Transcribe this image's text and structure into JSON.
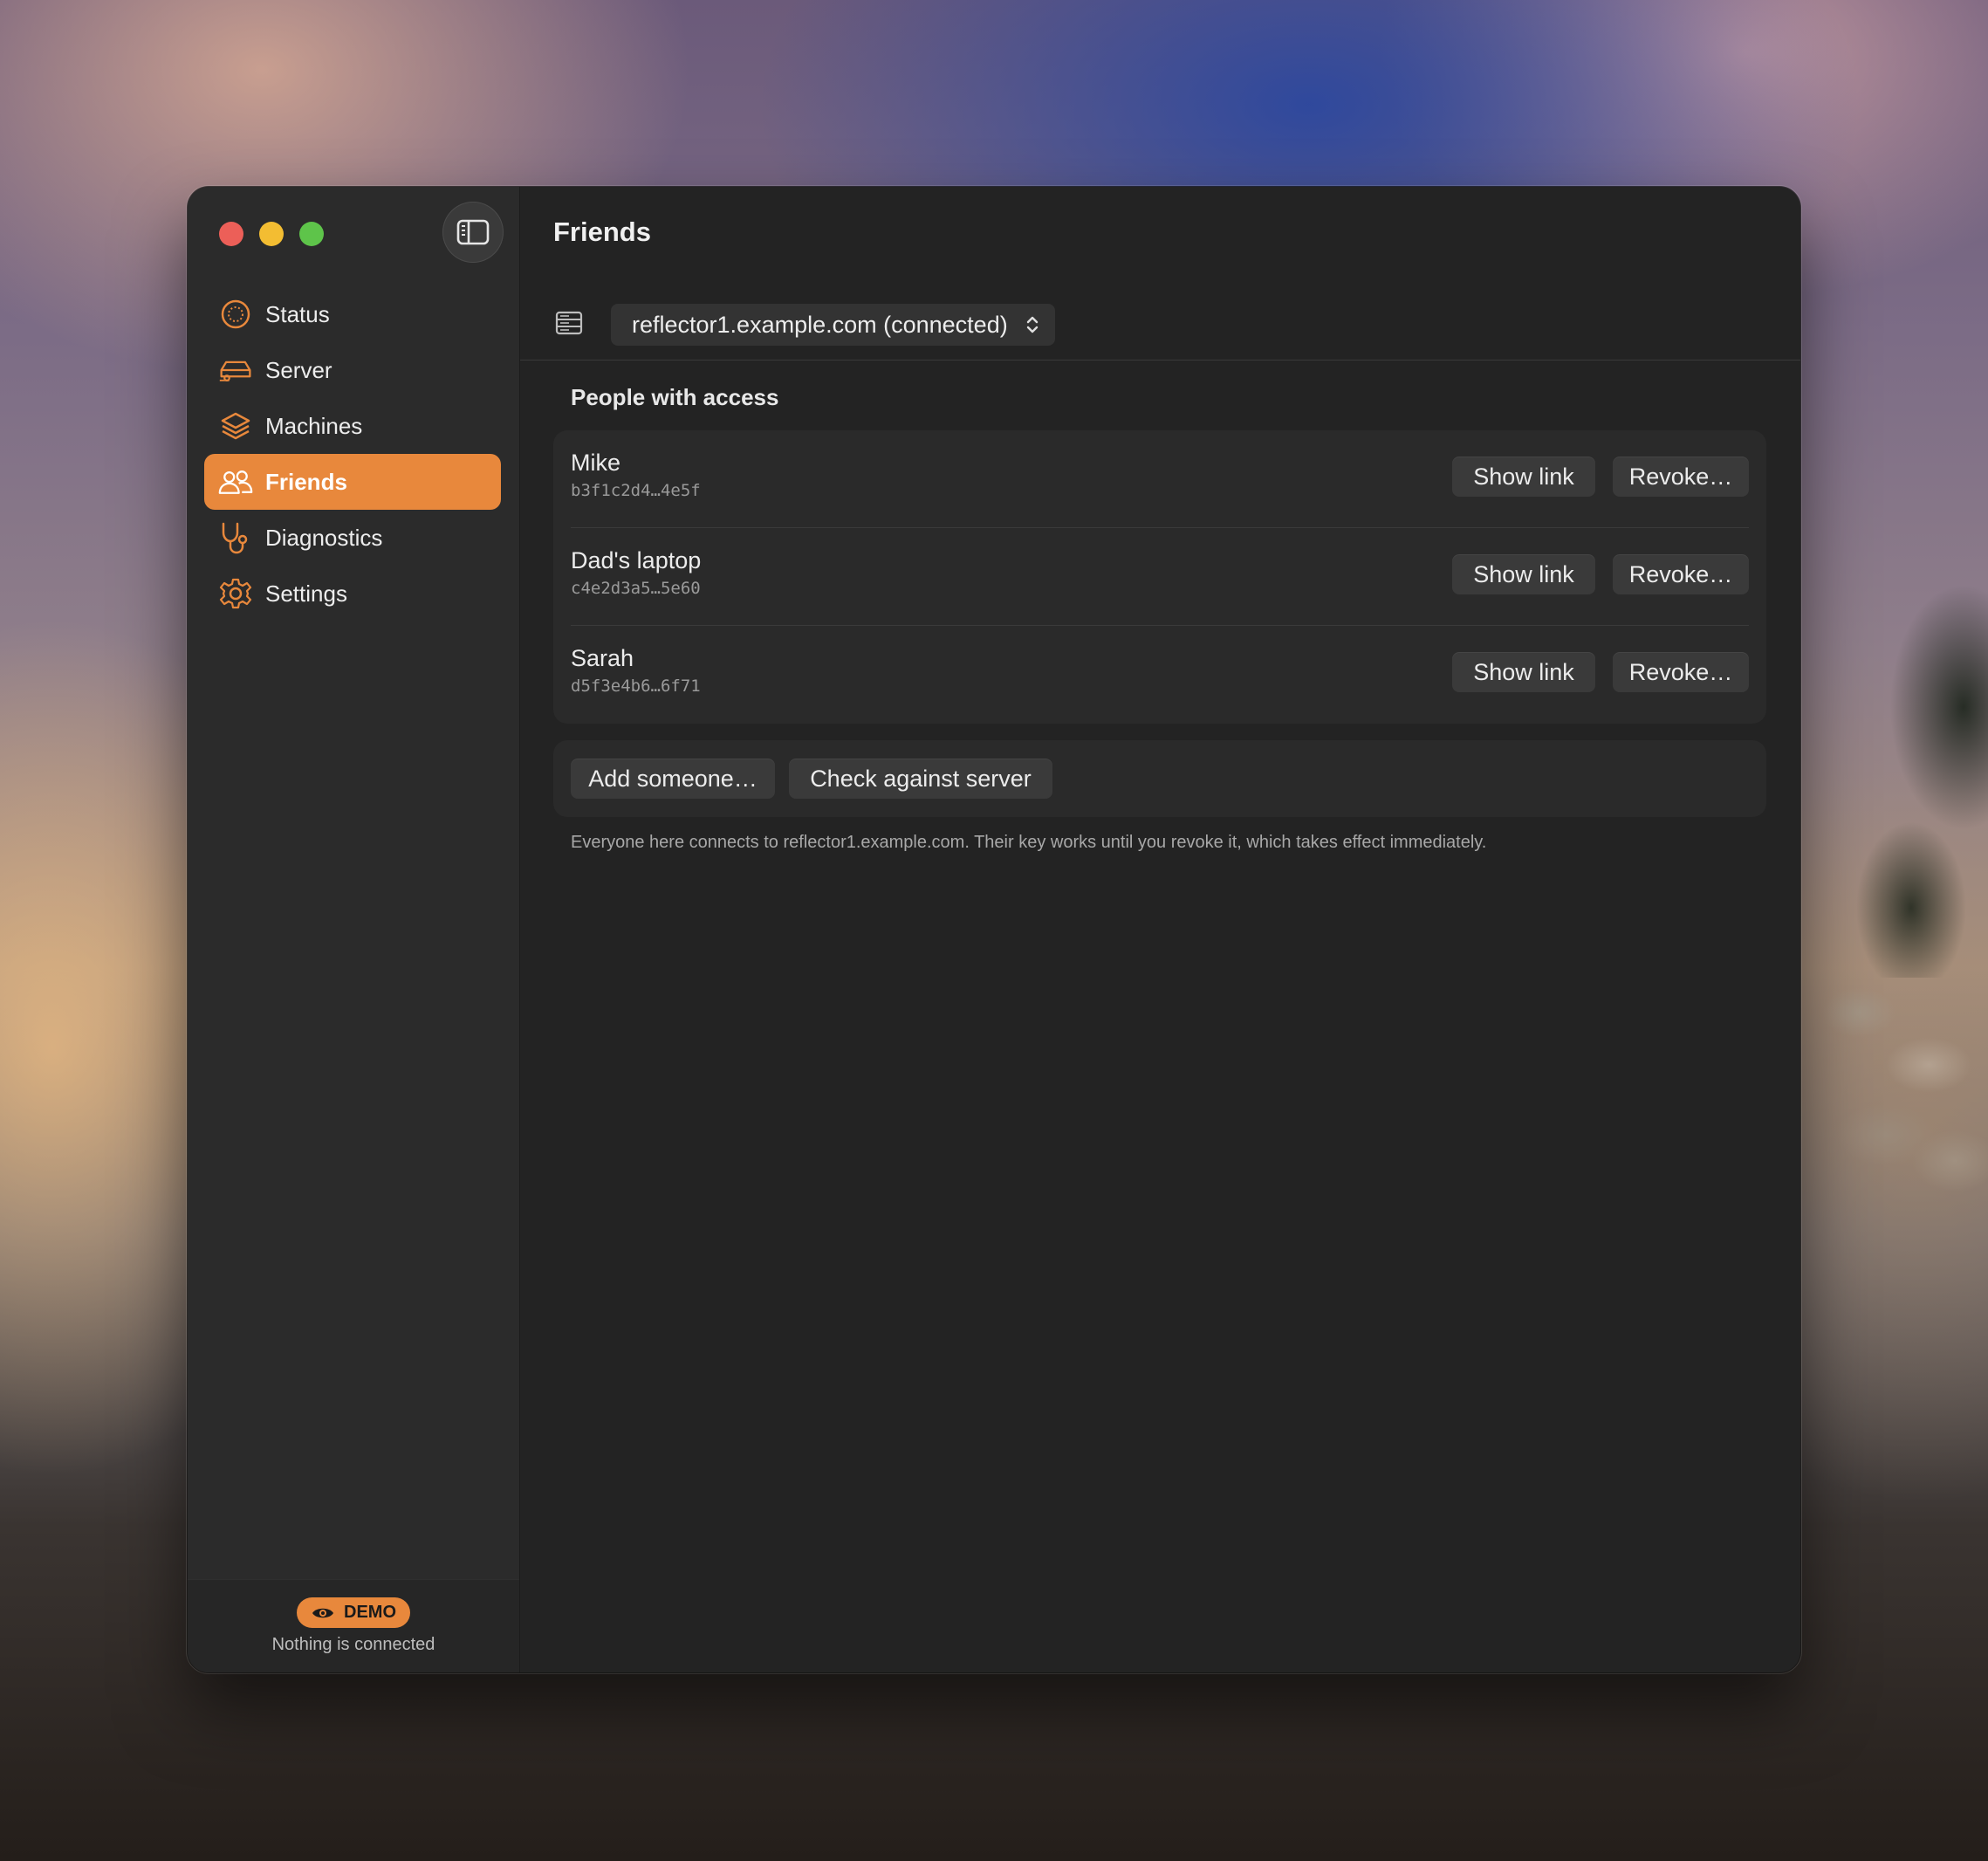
{
  "window": {
    "title": "Friends"
  },
  "sidebar": {
    "items": [
      {
        "label": "Status",
        "icon": "status-icon"
      },
      {
        "label": "Server",
        "icon": "server-car-icon"
      },
      {
        "label": "Machines",
        "icon": "layers-icon"
      },
      {
        "label": "Friends",
        "icon": "people-icon",
        "active": true
      },
      {
        "label": "Diagnostics",
        "icon": "stethoscope-icon"
      },
      {
        "label": "Settings",
        "icon": "gear-icon"
      }
    ],
    "footer": {
      "badge": "DEMO",
      "badge_icon": "eye-icon",
      "status": "Nothing is connected"
    }
  },
  "toolbar": {
    "server_select": "reflector1.example.com (connected)"
  },
  "main": {
    "section_title": "People with access",
    "people": [
      {
        "name": "Mike",
        "key": "b3f1c2d4…4e5f",
        "show_label": "Show link",
        "revoke_label": "Revoke…"
      },
      {
        "name": "Dad's laptop",
        "key": "c4e2d3a5…5e60",
        "show_label": "Show link",
        "revoke_label": "Revoke…"
      },
      {
        "name": "Sarah",
        "key": "d5f3e4b6…6f71",
        "show_label": "Show link",
        "revoke_label": "Revoke…"
      }
    ],
    "add_label": "Add someone…",
    "check_label": "Check against server",
    "note": "Everyone here connects to reflector1.example.com. Their key works until you revoke it, which takes effect immediately."
  },
  "colors": {
    "accent": "#e8883c",
    "window_bg": "#232323",
    "sidebar_bg": "#2b2b2b"
  }
}
